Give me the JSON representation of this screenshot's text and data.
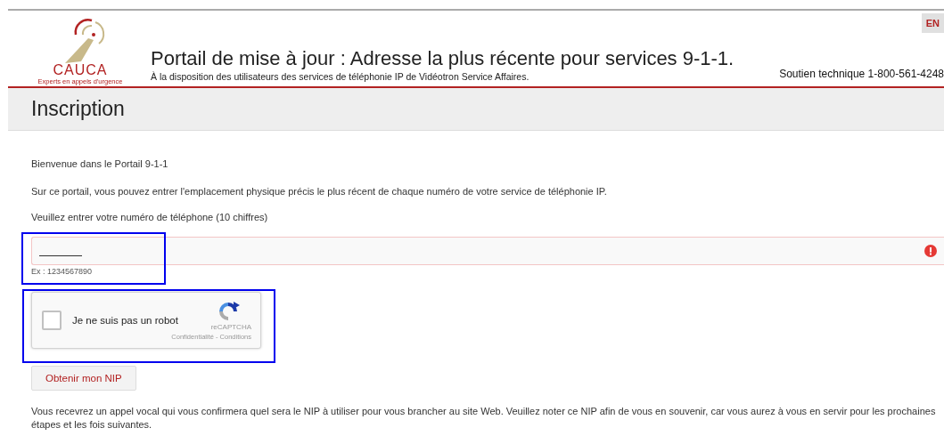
{
  "header": {
    "language_button": "EN",
    "title": "Portail de mise à jour : Adresse la plus récente pour services 9-1-1.",
    "subtitle": "À la disposition des utilisateurs des services de téléphonie IP de Vidéotron Service Affaires.",
    "support": "Soutien technique 1-800-561-4248",
    "logo": {
      "name": "CAUCA",
      "tagline": "Experts en appels d'urgence"
    }
  },
  "page_title": "Inscription",
  "intro": [
    "Bienvenue dans le Portail 9-1-1",
    "Sur ce portail, vous pouvez entrer l'emplacement physique précis le plus récent de chaque numéro de votre service de téléphonie IP."
  ],
  "phone_field": {
    "label": "Veuillez entrer votre numéro de téléphone (10 chiffres)",
    "hint": "Ex : 1234567890",
    "invalid": true
  },
  "captcha": {
    "label": "Je ne suis pas un robot",
    "checked": false,
    "brand": "reCAPTCHA",
    "links": "Confidentialité - Conditions"
  },
  "submit_button": "Obtenir mon NIP",
  "note": "Vous recevrez un appel vocal qui vous confirmera quel sera le NIP à utiliser pour vous brancher au site Web. Veuillez noter ce NIP afin de vous en souvenir, car vous aurez à vous en servir pour les prochaines étapes et les fois suivantes."
}
